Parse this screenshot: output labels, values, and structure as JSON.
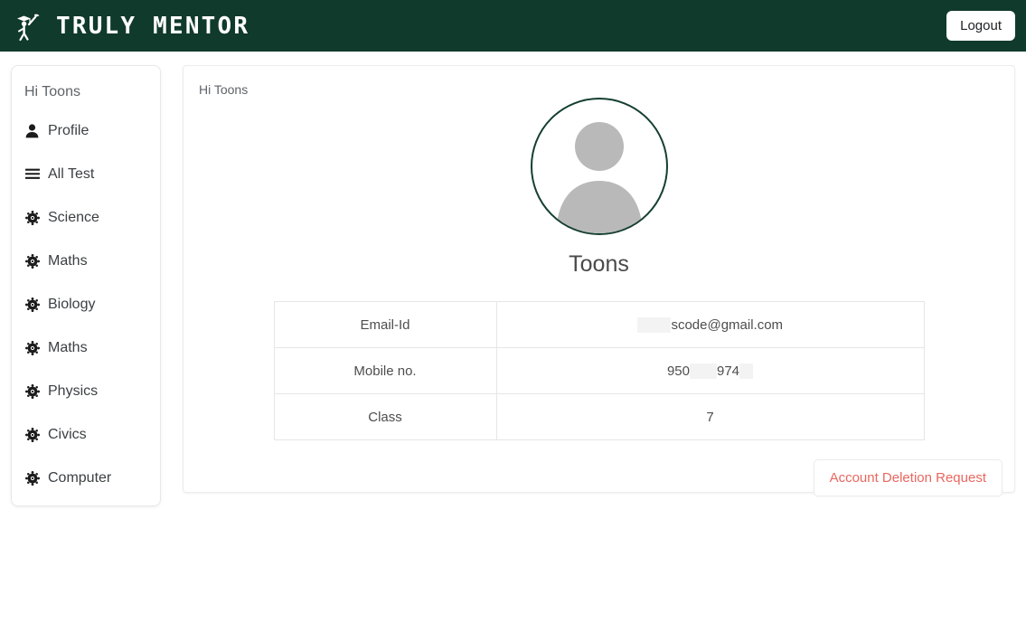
{
  "header": {
    "brand_name": "TRULY MENTOR",
    "logo_icon": "graduate-figure-icon",
    "logout_label": "Logout",
    "background_color": "#103a2b"
  },
  "sidebar": {
    "greeting": "Hi Toons",
    "items": [
      {
        "label": "Profile",
        "icon": "person-icon"
      },
      {
        "label": "All Test",
        "icon": "list-menu-icon"
      },
      {
        "label": "Science",
        "icon": "atom-icon"
      },
      {
        "label": "Maths",
        "icon": "atom-icon"
      },
      {
        "label": "Biology",
        "icon": "atom-icon"
      },
      {
        "label": "Maths",
        "icon": "atom-icon"
      },
      {
        "label": "Physics",
        "icon": "atom-icon"
      },
      {
        "label": "Civics",
        "icon": "atom-icon"
      },
      {
        "label": "Computer",
        "icon": "atom-icon"
      }
    ]
  },
  "main": {
    "breadcrumb": "Hi Toons",
    "avatar_icon": "default-user-avatar-icon",
    "avatar_border_color": "#153f2f",
    "profile_name": "Toons",
    "table": {
      "rows": [
        {
          "label": "Email-Id",
          "value": "scode@gmail.com",
          "redacted_prefix": true
        },
        {
          "label": "Mobile no.",
          "value": "950",
          "value_2": "974",
          "redacted_middle": true
        },
        {
          "label": "Class",
          "value": "7"
        }
      ]
    },
    "delete_button": {
      "label": "Account Deletion Request",
      "text_color": "#e8675f"
    }
  }
}
